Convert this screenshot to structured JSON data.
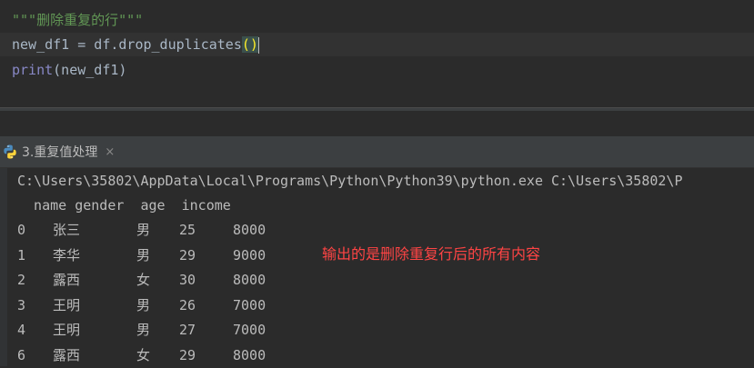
{
  "editor": {
    "docstring": "\"\"\"删除重复的行\"\"\"",
    "line2_before": "new_df1 = df.drop_duplicates",
    "line2_parens": "()",
    "line3_print": "print",
    "line3_args": "(new_df1)"
  },
  "run_tab": {
    "label": "3.重复值处理",
    "close": "×",
    "icon": "python-icon"
  },
  "console": {
    "command": "C:\\Users\\35802\\AppData\\Local\\Programs\\Python\\Python39\\python.exe C:\\Users\\35802\\P",
    "header": "  name gender  age  income",
    "rows": [
      {
        "idx": "0",
        "name": "张三",
        "gender": "男",
        "age": "25",
        "income": "8000"
      },
      {
        "idx": "1",
        "name": "李华",
        "gender": "男",
        "age": "29",
        "income": "9000"
      },
      {
        "idx": "2",
        "name": "露西",
        "gender": "女",
        "age": "30",
        "income": "8000"
      },
      {
        "idx": "3",
        "name": "王明",
        "gender": "男",
        "age": "26",
        "income": "7000"
      },
      {
        "idx": "4",
        "name": "王明",
        "gender": "男",
        "age": "27",
        "income": "7000"
      },
      {
        "idx": "6",
        "name": "露西",
        "gender": "女",
        "age": "29",
        "income": "8000"
      }
    ]
  },
  "annotation": "输出的是删除重复行后的所有内容",
  "colors": {
    "background": "#2b2b2b",
    "docstring": "#629755",
    "builtin": "#8888c6",
    "annotation": "#ff4444"
  }
}
